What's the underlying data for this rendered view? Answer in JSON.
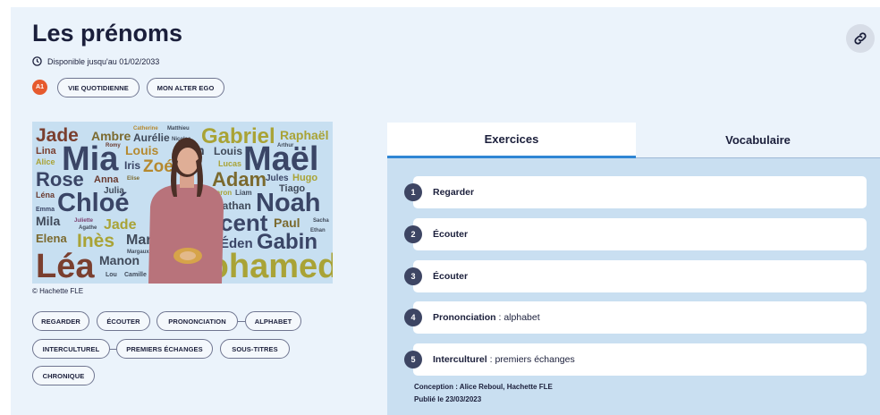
{
  "header": {
    "title": "Les prénoms",
    "availability": "Disponible jusqu'au 01/02/2033",
    "level": "A1",
    "tags": [
      "VIE QUOTIDIENNE",
      "MON ALTER EGO"
    ]
  },
  "media": {
    "credit": "© Hachette FLE",
    "words": [
      "Jade",
      "Ambre",
      "Catherine",
      "Matthieu",
      "Aurélie",
      "Nicolas",
      "Gabriel",
      "Raphaël",
      "Lina",
      "Romy",
      "Mia",
      "Louis",
      "Tom",
      "Louis",
      "Arthur",
      "Maël",
      "Alice",
      "Iris",
      "Zoé",
      "Lucas",
      "Rose",
      "Anna",
      "Elise",
      "Adam",
      "Jules",
      "Hugo",
      "Léna",
      "Julia",
      "Aaron",
      "Liam",
      "Tiago",
      "Emma",
      "Chloé",
      "Nathan",
      "Noah",
      "Mila",
      "Juliette",
      "Agathe",
      "Jade",
      "Vincent",
      "Paul",
      "Sacha",
      "Ethan",
      "Elena",
      "Inès",
      "Marie",
      "Thibault",
      "Éden",
      "Gabin",
      "Margaux",
      "Léa",
      "Manon",
      "Lou",
      "Camille",
      "Mohamed"
    ]
  },
  "activity_tags": [
    "REGARDER",
    "ÉCOUTER",
    "PRONONCIATION",
    "ALPHABET",
    "INTERCULTUREL",
    "PREMIERS ÉCHANGES",
    "SOUS-TITRES",
    "CHRONIQUE"
  ],
  "tabs": {
    "exercises": "Exercices",
    "vocabulary": "Vocabulaire"
  },
  "exercises": [
    {
      "num": "1",
      "title": "Regarder",
      "detail": ""
    },
    {
      "num": "2",
      "title": "Écouter",
      "detail": ""
    },
    {
      "num": "3",
      "title": "Écouter",
      "detail": ""
    },
    {
      "num": "4",
      "title": "Prononciation",
      "detail": " : alphabet"
    },
    {
      "num": "5",
      "title": "Interculturel",
      "detail": " : premiers échanges"
    }
  ],
  "meta": {
    "conception": "Conception : Alice Reboul, Hachette FLE",
    "published": "Publié le 23/03/2023"
  },
  "colors": {
    "accent": "#2f86d4",
    "level_badge": "#e65a2e",
    "panel_bg": "#c9dff1"
  }
}
